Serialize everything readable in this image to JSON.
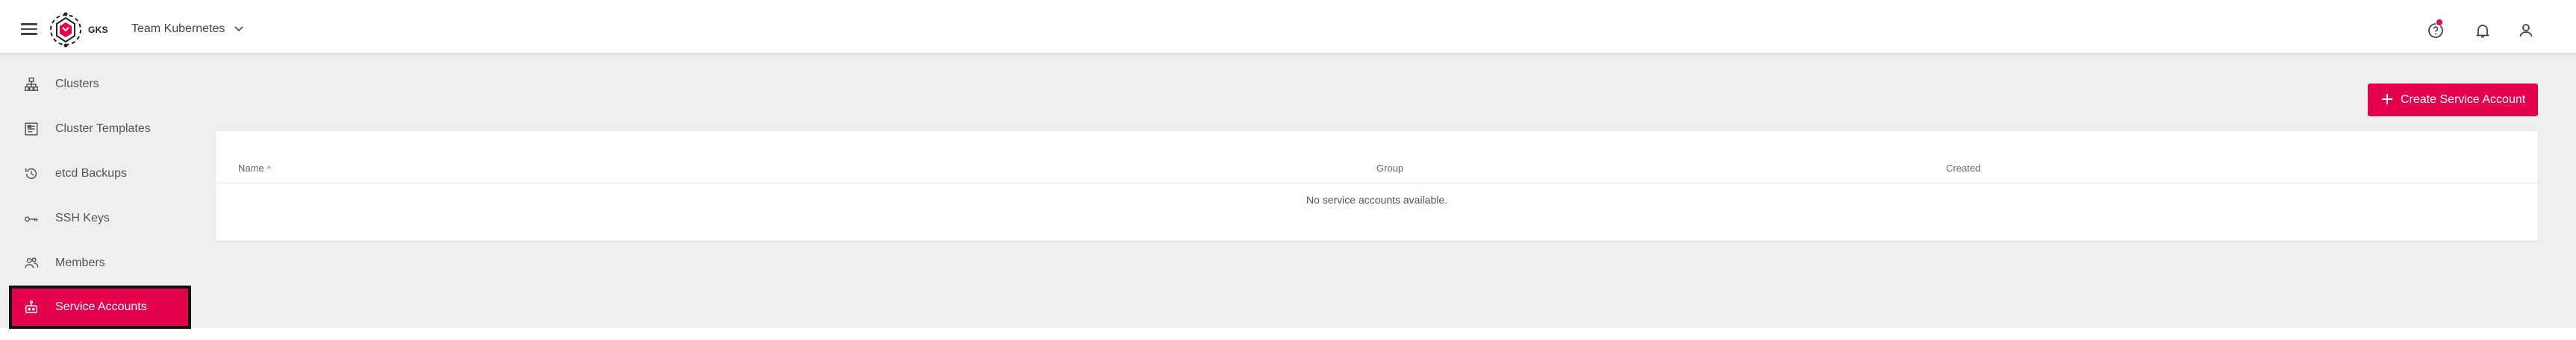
{
  "header": {
    "menu_icon": "hamburger-menu-icon",
    "logo_icon": "gks-logo-icon",
    "logo_text": "GKS",
    "project_name": "Team Kubernetes",
    "project_chevron_icon": "chevron-down-icon",
    "icons": [
      "help-icon",
      "bell-icon",
      "user-icon"
    ],
    "accent_color": "#e6004c"
  },
  "sidebar": {
    "items": [
      {
        "label": "Clusters",
        "icon": "cluster-icon"
      },
      {
        "label": "Cluster Templates",
        "icon": "template-icon"
      },
      {
        "label": "etcd Backups",
        "icon": "restore-icon"
      },
      {
        "label": "SSH Keys",
        "icon": "key-icon"
      },
      {
        "label": "Members",
        "icon": "members-icon"
      },
      {
        "label": "Service Accounts",
        "icon": "robot-icon",
        "active": true
      }
    ]
  },
  "main": {
    "create_button_label": "Create Service Account",
    "create_button_icon": "plus-icon",
    "table": {
      "columns": [
        {
          "label": "Name",
          "sort": "ascending",
          "sort_icon": "arrow-up-icon"
        },
        {
          "label": "Group"
        },
        {
          "label": "Created"
        }
      ],
      "empty_message": "No service accounts available."
    }
  }
}
